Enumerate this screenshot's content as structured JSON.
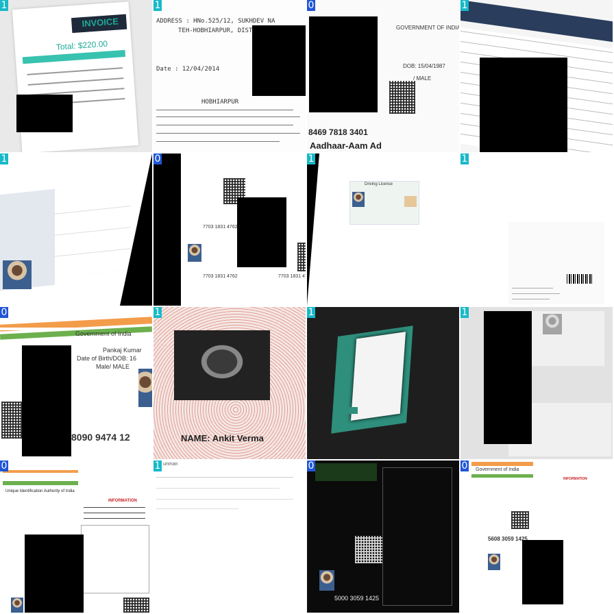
{
  "tiles": [
    {
      "label": "1",
      "texts": {
        "title": "INVOICE",
        "total": "Total: $220.00"
      }
    },
    {
      "label": "1",
      "texts": {
        "addr": "ADDRESS : HNo.525/12, SUKHDEV NA",
        "teh": "TEH-HOBHIARPUR, DIST-HO",
        "date": "Date : 12/04/2014",
        "sub": "HOBHIARPUR"
      }
    },
    {
      "label": "0",
      "texts": {
        "govt": "GOVERNMENT OF INDIA",
        "dob": "DOB: 15/04/1987",
        "male": "/ MALE",
        "num": "8469 7818 3401",
        "foot": "Aadhaar-Aam Ad"
      }
    },
    {
      "label": "1",
      "texts": {}
    },
    {
      "label": "1",
      "texts": {}
    },
    {
      "label": "0",
      "texts": {
        "num": "7703 1831 4762"
      }
    },
    {
      "label": "1",
      "texts": {
        "head": "Driving Licence"
      }
    },
    {
      "label": "1",
      "texts": {}
    },
    {
      "label": "0",
      "texts": {
        "govt": "Government of India",
        "name": "Pankaj Kumar",
        "dob": "Date of Birth/DOB: 16",
        "male": "Male/ MALE",
        "num": "8090 9474 12"
      }
    },
    {
      "label": "1",
      "texts": {
        "name": "NAME: Ankit Verma"
      }
    },
    {
      "label": "1",
      "texts": {}
    },
    {
      "label": "1",
      "texts": {}
    },
    {
      "label": "0",
      "texts": {
        "uidai": "Unique Identification Authority of India",
        "info": "INFORMATION"
      }
    },
    {
      "label": "1",
      "texts": {
        "head": "unman"
      }
    },
    {
      "label": "0",
      "texts": {
        "num": "5000 3059 1425"
      }
    },
    {
      "label": "0",
      "texts": {
        "govt": "Government of India",
        "info": "INFORMATION",
        "num": "5608 3059 1425"
      }
    }
  ]
}
